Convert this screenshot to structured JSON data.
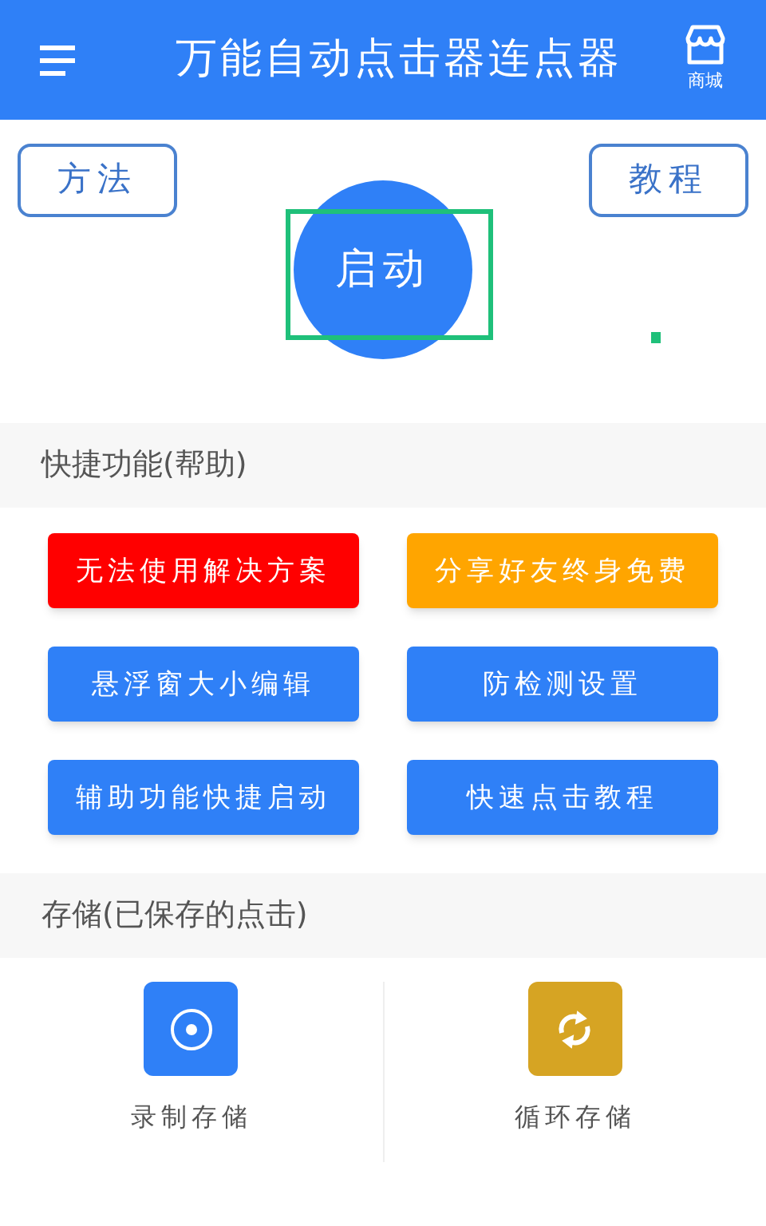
{
  "app_bar": {
    "title": "万能自动点击器连点器",
    "store_label": "商城"
  },
  "top_buttons": [
    "方法",
    "教程"
  ],
  "start_button": {
    "label": "启动"
  },
  "quick_section": {
    "title": "快捷功能(帮助)",
    "buttons": [
      {
        "label": "无法使用解决方案",
        "color": "#ff0000"
      },
      {
        "label": "分享好友终身免费",
        "color": "#ffa500"
      },
      {
        "label": "悬浮窗大小编辑",
        "color": "#2f80f7"
      },
      {
        "label": "防检测设置",
        "color": "#2f80f7"
      },
      {
        "label": "辅助功能快捷启动",
        "color": "#2f80f7"
      },
      {
        "label": "快速点击教程",
        "color": "#2f80f7"
      }
    ]
  },
  "storage_section": {
    "title": "存储(已保存的点击)",
    "items": [
      {
        "label": "录制存储",
        "kind": "record",
        "color": "#2f80f7"
      },
      {
        "label": "循环存储",
        "kind": "loop",
        "color": "#d6a423"
      }
    ]
  }
}
